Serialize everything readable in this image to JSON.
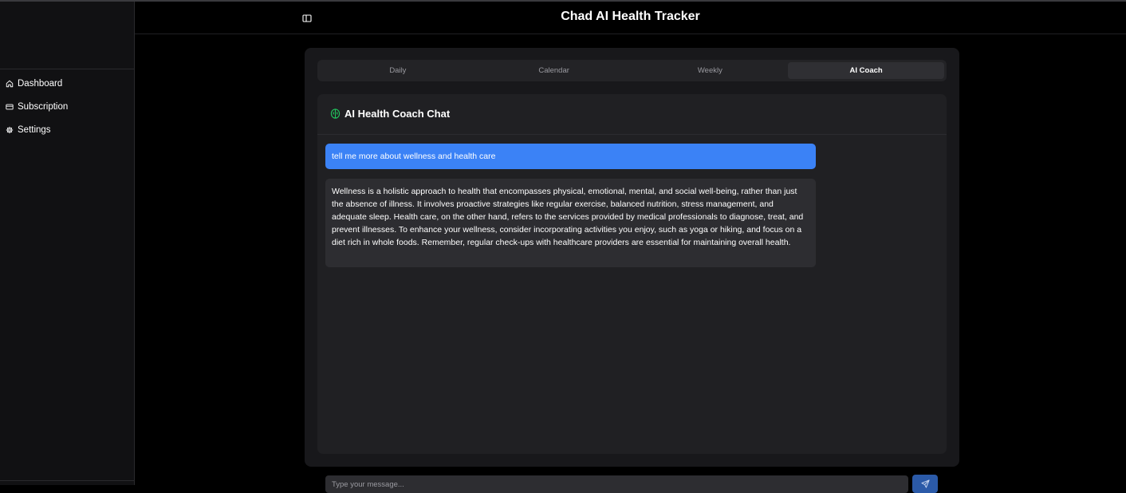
{
  "app": {
    "title": "Chad AI Health Tracker"
  },
  "sidebar": {
    "items": [
      {
        "label": "Dashboard",
        "icon": "home-icon"
      },
      {
        "label": "Subscription",
        "icon": "credit-card-icon"
      },
      {
        "label": "Settings",
        "icon": "gear-icon"
      }
    ]
  },
  "tabs": [
    {
      "label": "Daily",
      "active": false
    },
    {
      "label": "Calendar",
      "active": false
    },
    {
      "label": "Weekly",
      "active": false
    },
    {
      "label": "AI Coach",
      "active": true
    }
  ],
  "chat": {
    "title": "AI Health Coach Chat",
    "title_icon": "brain-icon",
    "messages": [
      {
        "role": "user",
        "text": "tell me more about wellness and health care"
      },
      {
        "role": "assistant",
        "text": "Wellness is a holistic approach to health that encompasses physical, emotional, mental, and social well-being, rather than just the absence of illness. It involves proactive strategies like regular exercise, balanced nutrition, stress management, and adequate sleep. Health care, on the other hand, refers to the services provided by medical professionals to diagnose, treat, and prevent illnesses. To enhance your wellness, consider incorporating activities you enjoy, such as yoga or hiking, and focus on a diet rich in whole foods. Remember, regular check-ups with healthcare providers are essential for maintaining overall health."
      }
    ],
    "input": {
      "placeholder": "Type your message...",
      "value": ""
    },
    "send_icon": "send-icon"
  },
  "colors": {
    "background": "#000000",
    "sidebar": "#111113",
    "card": "#18181b",
    "user_bubble": "#3b82f6",
    "ai_bubble": "#2d2d31",
    "send_button": "#2b5aa8",
    "brain_icon": "#22c55e"
  }
}
